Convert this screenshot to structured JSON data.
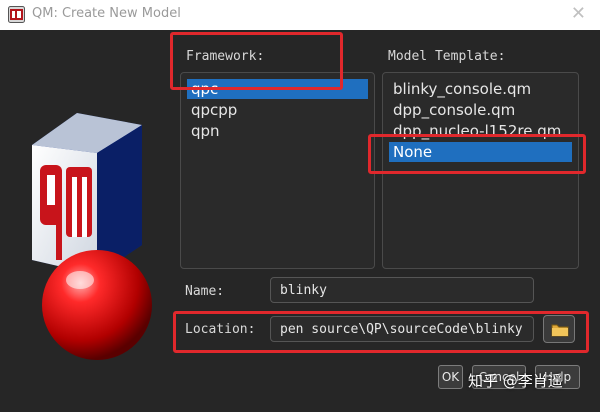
{
  "window": {
    "title": "QM: Create New Model",
    "close_glyph": "✕",
    "app_icon": "qm-app-icon"
  },
  "framework": {
    "label": "Framework:",
    "items": [
      "qpc",
      "qpcpp",
      "qpn"
    ],
    "selected": "qpc"
  },
  "template": {
    "label": "Model Template:",
    "items": [
      "blinky_console.qm",
      "dpp_console.qm",
      "dpp_nucleo-l152re.qm",
      "None"
    ],
    "selected": "None"
  },
  "name": {
    "label": "Name:",
    "value": "blinky"
  },
  "location": {
    "label": "Location:",
    "value": "pen source\\QP\\sourceCode\\blinky",
    "browse_icon": "folder-icon"
  },
  "buttons": {
    "ok": "OK",
    "cancel": "Cancel",
    "help": "Help"
  },
  "watermark": "知乎 @李肖遥",
  "colors": {
    "dialog_bg": "#262626",
    "selection": "#1f6fbf",
    "highlight_box": "#e0282c"
  }
}
